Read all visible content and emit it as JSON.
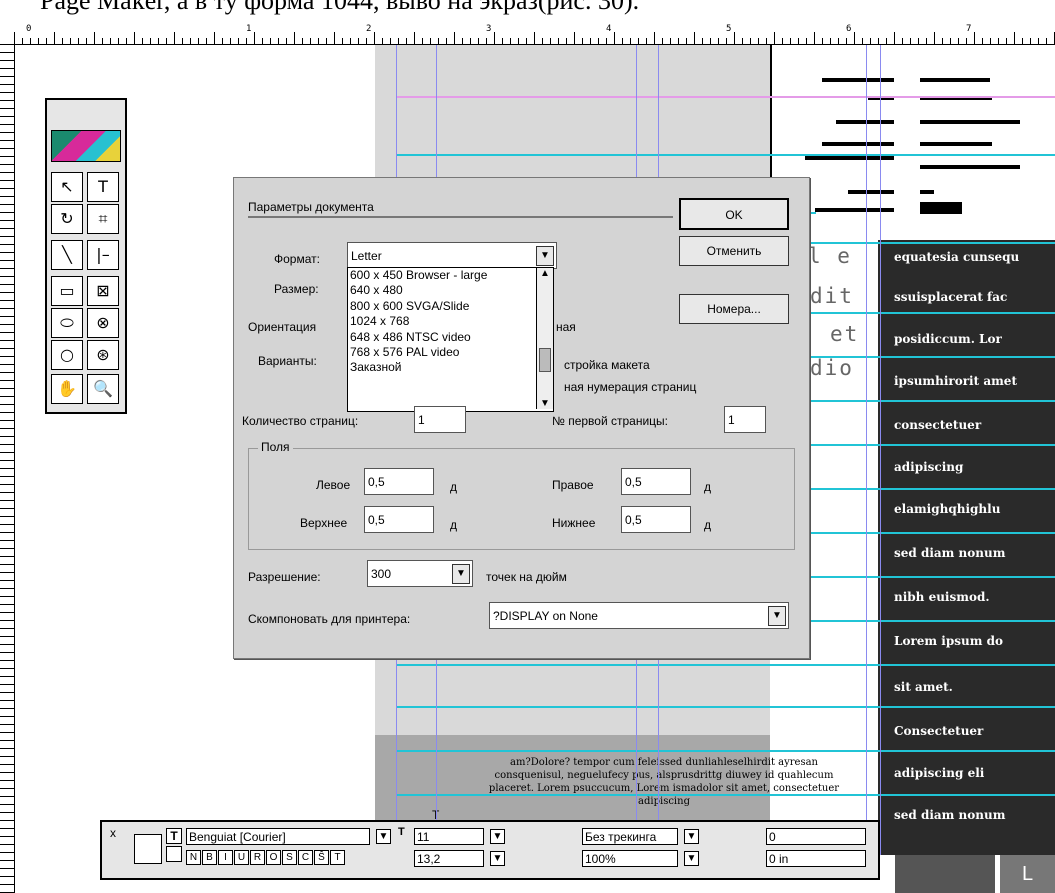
{
  "caption": "Page Maker, а в ту форма 1044, выво на экраз(рис. 30).",
  "ruler": {
    "marks": [
      "0",
      "1",
      "2",
      "3",
      "4",
      "5",
      "6",
      "7"
    ]
  },
  "toolbox": {
    "tools": [
      "pointer-icon",
      "text-icon",
      "rotate-icon",
      "crop-icon",
      "line-icon",
      "constrained-line-icon",
      "rectangle-icon",
      "rectangle-frame-icon",
      "ellipse-icon",
      "ellipse-frame-icon",
      "polygon-icon",
      "polygon-frame-icon",
      "hand-icon",
      "zoom-icon"
    ]
  },
  "dialog": {
    "title": "Параметры документа",
    "ok_label": "OK",
    "cancel_label": "Отменить",
    "numbers_label": "Номера...",
    "format_label": "Формат:",
    "format_value": "Letter",
    "size_label": "Размер:",
    "orientation_label": "Ориентация",
    "orientation_suffix": "ная",
    "variants_label": "Варианты:",
    "variant_1": "стройка макета",
    "variant_2": "ная нумерация страниц",
    "format_options": [
      "600 x 450  Browser - large",
      "640 x 480",
      "800 x 600  SVGA/Slide",
      "1024 x 768",
      "648 x 486  NTSC video",
      "768 x 576  PAL video",
      "Заказной"
    ],
    "pages_count_label": "Количество страниц:",
    "pages_count_value": "1",
    "first_page_label": "№ первой страницы:",
    "first_page_value": "1",
    "margins_group_label": "Поля",
    "left_label": "Левое",
    "left_value": "0,5",
    "right_label": "Правое",
    "right_value": "0,5",
    "top_label": "Верхнее",
    "top_value": "0,5",
    "bottom_label": "Нижнее",
    "bottom_value": "0,5",
    "unit": "д",
    "resolution_label": "Разрешение:",
    "resolution_value": "300",
    "resolution_unit": "точек на дюйм",
    "printer_label": "Скомпоновать для принтера:",
    "printer_value": "?DISPLAY on None"
  },
  "canvas": {
    "mono_lines": [
      "l e",
      "dit",
      "et",
      "dio"
    ],
    "dark_lines": [
      "equatesia cunsequ",
      "ssuisplacerat fac",
      "posidiccum. Lor",
      "ipsumhirorit amet",
      "consectetuer",
      "adipiscing",
      "elamighqhighlu",
      "sed diam nonum",
      "nibh euismod.",
      "Lorem ipsum do",
      "sit amet.",
      "Consectetuer",
      "adipiscing eli",
      "sed diam nonum"
    ],
    "sample_text": "am?Dolore? tempor cum feleissed dunliahleselhirdit ayresan consquenisul, neguelufecy pus, alsprusdrittg diuwey id quahlecum placeret. Lorem psuccucum, Lorem ismadolor sit amet, consectetuer adipiscing",
    "small_letter": "T",
    "corner_letter": "L"
  },
  "palette": {
    "font_value": "Benguiat [Courier]",
    "size_value": "11",
    "leading_value": "13,2",
    "tracking_value": "Без трекинга",
    "width_value": "100%",
    "kern_value": "0",
    "baseline_value": "0 in",
    "close_glyph": "x",
    "t_label": "T",
    "icon_t": "T",
    "style_letters": [
      "N",
      "B",
      "I",
      "U",
      "R",
      "O",
      "S",
      "C",
      "Ŝ",
      "T"
    ]
  }
}
